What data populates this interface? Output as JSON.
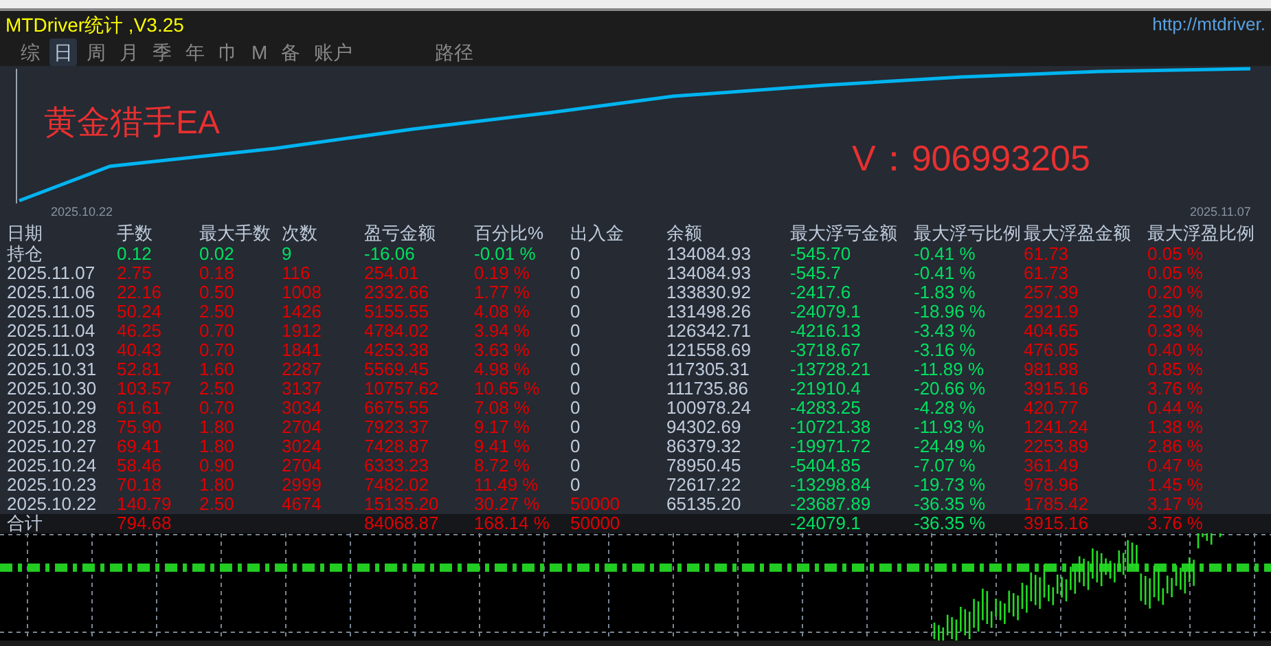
{
  "window": {
    "title": "MTDriver统计 ,V3.25",
    "url": "http://mtdriver."
  },
  "tabs": [
    {
      "label": "综",
      "selected": false
    },
    {
      "label": "日",
      "selected": true
    },
    {
      "label": "周",
      "selected": false
    },
    {
      "label": "月",
      "selected": false
    },
    {
      "label": "季",
      "selected": false
    },
    {
      "label": "年",
      "selected": false
    },
    {
      "label": "巾",
      "selected": false
    },
    {
      "label": "M",
      "selected": false
    },
    {
      "label": "备",
      "selected": false
    },
    {
      "label": "账户",
      "selected": false
    },
    {
      "label": "路径",
      "selected": false
    }
  ],
  "equity_chart": {
    "start_date": "2025.10.22",
    "end_date": "2025.11.07",
    "labels": [
      {
        "text": "黄金猎手EA",
        "kind": "title"
      },
      {
        "text": "V：906993205",
        "kind": "contact"
      }
    ]
  },
  "table": {
    "label_column": "日期",
    "columns": [
      "手数",
      "最大手数",
      "次数",
      "盈亏金额",
      "百分比%",
      "出入金",
      "余额",
      "最大浮亏金额",
      "最大浮亏比例",
      "最大浮盈金额",
      "最大浮盈比例"
    ],
    "rows": [
      {
        "label": "持仓",
        "kind": "position",
        "cells": [
          {
            "text": "0.12",
            "color": "#00e060"
          },
          {
            "text": "0.02",
            "color": "#00e060"
          },
          {
            "text": "9",
            "color": "#00e060"
          },
          {
            "text": "-16.06",
            "color": "#00e060"
          },
          {
            "text": "-0.01 %",
            "color": "#00e060"
          },
          {
            "text": "0",
            "color": "#c0ccdc"
          },
          {
            "text": "134084.93",
            "color": "#c0ccdc"
          },
          {
            "text": "-545.70",
            "color": "#00e060"
          },
          {
            "text": "-0.41 %",
            "color": "#00e060"
          },
          {
            "text": "61.73",
            "color": "#e00000"
          },
          {
            "text": "0.05 %",
            "color": "#e00000"
          }
        ]
      },
      {
        "label": "2025.11.07",
        "kind": "day",
        "cells": [
          {
            "text": "2.75",
            "color": "#e00000"
          },
          {
            "text": "0.18",
            "color": "#e00000"
          },
          {
            "text": "116",
            "color": "#e00000"
          },
          {
            "text": "254.01",
            "color": "#e00000"
          },
          {
            "text": "0.19 %",
            "color": "#e00000"
          },
          {
            "text": "0",
            "color": "#c0ccdc"
          },
          {
            "text": "134084.93",
            "color": "#c0ccdc"
          },
          {
            "text": "-545.7",
            "color": "#00e060"
          },
          {
            "text": "-0.41 %",
            "color": "#00e060"
          },
          {
            "text": "61.73",
            "color": "#e00000"
          },
          {
            "text": "0.05 %",
            "color": "#e00000"
          }
        ]
      },
      {
        "label": "2025.11.06",
        "kind": "day",
        "cells": [
          {
            "text": "22.16",
            "color": "#e00000"
          },
          {
            "text": "0.50",
            "color": "#e00000"
          },
          {
            "text": "1008",
            "color": "#e00000"
          },
          {
            "text": "2332.66",
            "color": "#e00000"
          },
          {
            "text": "1.77 %",
            "color": "#e00000"
          },
          {
            "text": "0",
            "color": "#c0ccdc"
          },
          {
            "text": "133830.92",
            "color": "#c0ccdc"
          },
          {
            "text": "-2417.6",
            "color": "#00e060"
          },
          {
            "text": "-1.83 %",
            "color": "#00e060"
          },
          {
            "text": "257.39",
            "color": "#e00000"
          },
          {
            "text": "0.20 %",
            "color": "#e00000"
          }
        ]
      },
      {
        "label": "2025.11.05",
        "kind": "day",
        "cells": [
          {
            "text": "50.24",
            "color": "#e00000"
          },
          {
            "text": "2.50",
            "color": "#e00000"
          },
          {
            "text": "1426",
            "color": "#e00000"
          },
          {
            "text": "5155.55",
            "color": "#e00000"
          },
          {
            "text": "4.08 %",
            "color": "#e00000"
          },
          {
            "text": "0",
            "color": "#c0ccdc"
          },
          {
            "text": "131498.26",
            "color": "#c0ccdc"
          },
          {
            "text": "-24079.1",
            "color": "#00e060"
          },
          {
            "text": "-18.96 %",
            "color": "#00e060"
          },
          {
            "text": "2921.9",
            "color": "#e00000"
          },
          {
            "text": "2.30 %",
            "color": "#e00000"
          }
        ]
      },
      {
        "label": "2025.11.04",
        "kind": "day",
        "cells": [
          {
            "text": "46.25",
            "color": "#e00000"
          },
          {
            "text": "0.70",
            "color": "#e00000"
          },
          {
            "text": "1912",
            "color": "#e00000"
          },
          {
            "text": "4784.02",
            "color": "#e00000"
          },
          {
            "text": "3.94 %",
            "color": "#e00000"
          },
          {
            "text": "0",
            "color": "#c0ccdc"
          },
          {
            "text": "126342.71",
            "color": "#c0ccdc"
          },
          {
            "text": "-4216.13",
            "color": "#00e060"
          },
          {
            "text": "-3.43 %",
            "color": "#00e060"
          },
          {
            "text": "404.65",
            "color": "#e00000"
          },
          {
            "text": "0.33 %",
            "color": "#e00000"
          }
        ]
      },
      {
        "label": "2025.11.03",
        "kind": "day",
        "cells": [
          {
            "text": "40.43",
            "color": "#e00000"
          },
          {
            "text": "0.70",
            "color": "#e00000"
          },
          {
            "text": "1841",
            "color": "#e00000"
          },
          {
            "text": "4253.38",
            "color": "#e00000"
          },
          {
            "text": "3.63 %",
            "color": "#e00000"
          },
          {
            "text": "0",
            "color": "#c0ccdc"
          },
          {
            "text": "121558.69",
            "color": "#c0ccdc"
          },
          {
            "text": "-3718.67",
            "color": "#00e060"
          },
          {
            "text": "-3.16 %",
            "color": "#00e060"
          },
          {
            "text": "476.05",
            "color": "#e00000"
          },
          {
            "text": "0.40 %",
            "color": "#e00000"
          }
        ]
      },
      {
        "label": "2025.10.31",
        "kind": "day",
        "cells": [
          {
            "text": "52.81",
            "color": "#e00000"
          },
          {
            "text": "1.60",
            "color": "#e00000"
          },
          {
            "text": "2287",
            "color": "#e00000"
          },
          {
            "text": "5569.45",
            "color": "#e00000"
          },
          {
            "text": "4.98 %",
            "color": "#e00000"
          },
          {
            "text": "0",
            "color": "#c0ccdc"
          },
          {
            "text": "117305.31",
            "color": "#c0ccdc"
          },
          {
            "text": "-13728.21",
            "color": "#00e060"
          },
          {
            "text": "-11.89 %",
            "color": "#00e060"
          },
          {
            "text": "981.88",
            "color": "#e00000"
          },
          {
            "text": "0.85 %",
            "color": "#e00000"
          }
        ]
      },
      {
        "label": "2025.10.30",
        "kind": "day",
        "cells": [
          {
            "text": "103.57",
            "color": "#e00000"
          },
          {
            "text": "2.50",
            "color": "#e00000"
          },
          {
            "text": "3137",
            "color": "#e00000"
          },
          {
            "text": "10757.62",
            "color": "#e00000"
          },
          {
            "text": "10.65 %",
            "color": "#e00000"
          },
          {
            "text": "0",
            "color": "#c0ccdc"
          },
          {
            "text": "111735.86",
            "color": "#c0ccdc"
          },
          {
            "text": "-21910.4",
            "color": "#00e060"
          },
          {
            "text": "-20.66 %",
            "color": "#00e060"
          },
          {
            "text": "3915.16",
            "color": "#e00000"
          },
          {
            "text": "3.76 %",
            "color": "#e00000"
          }
        ]
      },
      {
        "label": "2025.10.29",
        "kind": "day",
        "cells": [
          {
            "text": "61.61",
            "color": "#e00000"
          },
          {
            "text": "0.70",
            "color": "#e00000"
          },
          {
            "text": "3034",
            "color": "#e00000"
          },
          {
            "text": "6675.55",
            "color": "#e00000"
          },
          {
            "text": "7.08 %",
            "color": "#e00000"
          },
          {
            "text": "0",
            "color": "#c0ccdc"
          },
          {
            "text": "100978.24",
            "color": "#c0ccdc"
          },
          {
            "text": "-4283.25",
            "color": "#00e060"
          },
          {
            "text": "-4.28 %",
            "color": "#00e060"
          },
          {
            "text": "420.77",
            "color": "#e00000"
          },
          {
            "text": "0.44 %",
            "color": "#e00000"
          }
        ]
      },
      {
        "label": "2025.10.28",
        "kind": "day",
        "cells": [
          {
            "text": "75.90",
            "color": "#e00000"
          },
          {
            "text": "1.80",
            "color": "#e00000"
          },
          {
            "text": "2704",
            "color": "#e00000"
          },
          {
            "text": "7923.37",
            "color": "#e00000"
          },
          {
            "text": "9.17 %",
            "color": "#e00000"
          },
          {
            "text": "0",
            "color": "#c0ccdc"
          },
          {
            "text": "94302.69",
            "color": "#c0ccdc"
          },
          {
            "text": "-10721.38",
            "color": "#00e060"
          },
          {
            "text": "-11.93 %",
            "color": "#00e060"
          },
          {
            "text": "1241.24",
            "color": "#e00000"
          },
          {
            "text": "1.38 %",
            "color": "#e00000"
          }
        ]
      },
      {
        "label": "2025.10.27",
        "kind": "day",
        "cells": [
          {
            "text": "69.41",
            "color": "#e00000"
          },
          {
            "text": "1.80",
            "color": "#e00000"
          },
          {
            "text": "3024",
            "color": "#e00000"
          },
          {
            "text": "7428.87",
            "color": "#e00000"
          },
          {
            "text": "9.41 %",
            "color": "#e00000"
          },
          {
            "text": "0",
            "color": "#c0ccdc"
          },
          {
            "text": "86379.32",
            "color": "#c0ccdc"
          },
          {
            "text": "-19971.72",
            "color": "#00e060"
          },
          {
            "text": "-24.49 %",
            "color": "#00e060"
          },
          {
            "text": "2253.89",
            "color": "#e00000"
          },
          {
            "text": "2.86 %",
            "color": "#e00000"
          }
        ]
      },
      {
        "label": "2025.10.24",
        "kind": "day",
        "cells": [
          {
            "text": "58.46",
            "color": "#e00000"
          },
          {
            "text": "0.90",
            "color": "#e00000"
          },
          {
            "text": "2704",
            "color": "#e00000"
          },
          {
            "text": "6333.23",
            "color": "#e00000"
          },
          {
            "text": "8.72 %",
            "color": "#e00000"
          },
          {
            "text": "0",
            "color": "#c0ccdc"
          },
          {
            "text": "78950.45",
            "color": "#c0ccdc"
          },
          {
            "text": "-5404.85",
            "color": "#00e060"
          },
          {
            "text": "-7.07 %",
            "color": "#00e060"
          },
          {
            "text": "361.49",
            "color": "#e00000"
          },
          {
            "text": "0.47 %",
            "color": "#e00000"
          }
        ]
      },
      {
        "label": "2025.10.23",
        "kind": "day",
        "cells": [
          {
            "text": "70.18",
            "color": "#e00000"
          },
          {
            "text": "1.80",
            "color": "#e00000"
          },
          {
            "text": "2999",
            "color": "#e00000"
          },
          {
            "text": "7482.02",
            "color": "#e00000"
          },
          {
            "text": "11.49 %",
            "color": "#e00000"
          },
          {
            "text": "0",
            "color": "#c0ccdc"
          },
          {
            "text": "72617.22",
            "color": "#c0ccdc"
          },
          {
            "text": "-13298.84",
            "color": "#00e060"
          },
          {
            "text": "-19.73 %",
            "color": "#00e060"
          },
          {
            "text": "978.96",
            "color": "#e00000"
          },
          {
            "text": "1.45 %",
            "color": "#e00000"
          }
        ]
      },
      {
        "label": "2025.10.22",
        "kind": "day",
        "cells": [
          {
            "text": "140.79",
            "color": "#e00000"
          },
          {
            "text": "2.50",
            "color": "#e00000"
          },
          {
            "text": "4674",
            "color": "#e00000"
          },
          {
            "text": "15135.20",
            "color": "#e00000"
          },
          {
            "text": "30.27 %",
            "color": "#e00000"
          },
          {
            "text": "50000",
            "color": "#e00000"
          },
          {
            "text": "65135.20",
            "color": "#c0ccdc"
          },
          {
            "text": "-23687.89",
            "color": "#00e060"
          },
          {
            "text": "-36.35 %",
            "color": "#00e060"
          },
          {
            "text": "1785.42",
            "color": "#e00000"
          },
          {
            "text": "3.17 %",
            "color": "#e00000"
          }
        ]
      },
      {
        "label": "合计",
        "kind": "total",
        "cells": [
          {
            "text": "794.68",
            "color": "#e00000"
          },
          null,
          null,
          {
            "text": "84068.87",
            "color": "#e00000"
          },
          {
            "text": "168.14 %",
            "color": "#e00000"
          },
          {
            "text": "50000",
            "color": "#e00000"
          },
          null,
          {
            "text": "-24079.1",
            "color": "#00e060"
          },
          {
            "text": "-36.35 %",
            "color": "#00e060"
          },
          {
            "text": "3915.16",
            "color": "#e00000"
          },
          {
            "text": "3.76 %",
            "color": "#e00000"
          }
        ]
      }
    ]
  }
}
